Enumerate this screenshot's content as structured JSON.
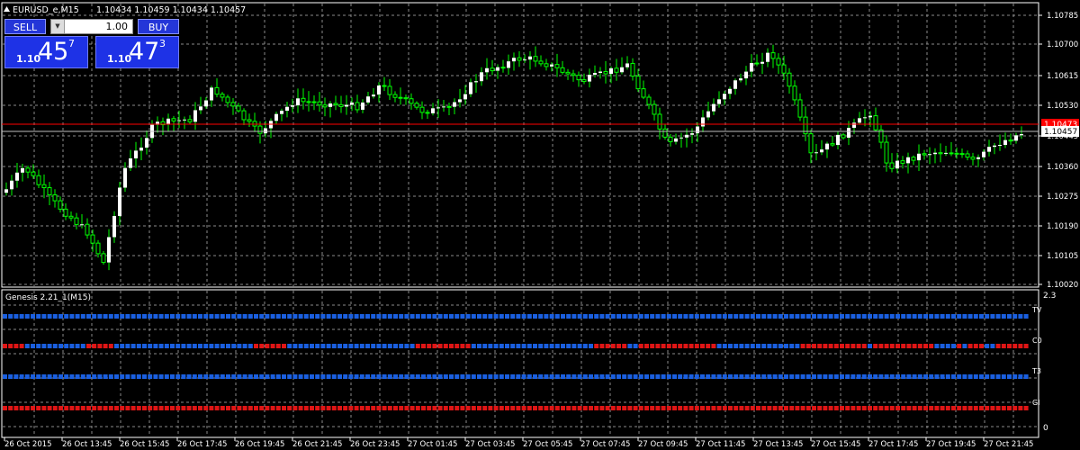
{
  "window": {
    "symbol_label": "EURUSD_e,M15",
    "ohlc_text": "1.10434 1.10459 1.10434 1.10457",
    "menu_icon": "triangle-up-icon"
  },
  "trade_panel": {
    "sell_label": "SELL",
    "buy_label": "BUY",
    "lot_value": "1.00",
    "sell_price": {
      "prefix": "1.10",
      "big": "45",
      "sup": "7"
    },
    "buy_price": {
      "prefix": "1.10",
      "big": "47",
      "sup": "3"
    }
  },
  "price_axis": {
    "labels": [
      "1.10785",
      "1.10700",
      "1.10615",
      "1.10530",
      "1.10445",
      "1.10360",
      "1.10275",
      "1.10190",
      "1.10105",
      "1.10020"
    ],
    "current_price": "1.10457",
    "ask_price": "1.10473"
  },
  "time_axis": {
    "labels": [
      "26 Oct 2015",
      "26 Oct 13:45",
      "26 Oct 15:45",
      "26 Oct 17:45",
      "26 Oct 19:45",
      "26 Oct 21:45",
      "26 Oct 23:45",
      "27 Oct 01:45",
      "27 Oct 03:45",
      "27 Oct 05:45",
      "27 Oct 07:45",
      "27 Oct 09:45",
      "27 Oct 11:45",
      "27 Oct 13:45",
      "27 Oct 15:45",
      "27 Oct 17:45",
      "27 Oct 19:45",
      "27 Oct 21:45"
    ]
  },
  "indicator": {
    "title": "Genesis 2.21_1(M15)",
    "scale_top": "2.3",
    "scale_bottom": "0",
    "rows": [
      {
        "label": "TV"
      },
      {
        "label": "C0"
      },
      {
        "label": "T3"
      },
      {
        "label": "GI"
      }
    ]
  },
  "colors": {
    "background": "#000000",
    "grid": "#8a8a8a",
    "bull_candle": "#ffffff",
    "bear_candle": "#000000",
    "wick": "#00ff00",
    "bid_line": "#c0c0c0",
    "ask_line": "#ff0000",
    "dot_blue": "#1a5fe0",
    "dot_red": "#e01515"
  }
}
